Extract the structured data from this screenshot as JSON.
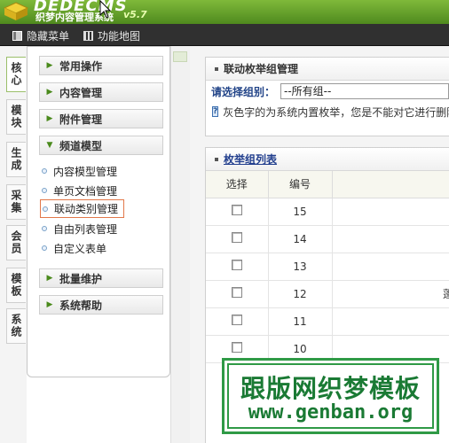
{
  "header": {
    "logo": "DEDECMS",
    "subtitle": "织梦内容管理系统",
    "version": "v5.7"
  },
  "toolbar": {
    "hide_menu": "隐藏菜单",
    "sitemap": "功能地图"
  },
  "vtabs": [
    "核心",
    "模块",
    "生成",
    "采集",
    "会员",
    "模板",
    "系统"
  ],
  "sidebar": {
    "groups": [
      "常用操作",
      "内容管理",
      "附件管理",
      "频道模型",
      "批量维护",
      "系统帮助"
    ],
    "items": [
      "内容模型管理",
      "单页文档管理",
      "联动类别管理",
      "自由列表管理",
      "自定义表单"
    ]
  },
  "panel1": {
    "title": "联动枚举组管理",
    "select_label": "请选择组别：",
    "select_value": "--所有组--",
    "note": "灰色字的为系统内置枚举，您是不能对它进行删除"
  },
  "panel2": {
    "title": "枚举组列表",
    "col_select": "选择",
    "col_id": "编号",
    "rows": [
      "15",
      "14",
      "13",
      "12",
      "11",
      "10"
    ],
    "row12_extra": "蓬"
  },
  "watermark": {
    "cn": "跟版网织梦模板",
    "en": "www.genban.org"
  },
  "colors": {
    "header": "#6aa72e",
    "toolbar": "#303030",
    "active_item_border": "#e2784a"
  }
}
